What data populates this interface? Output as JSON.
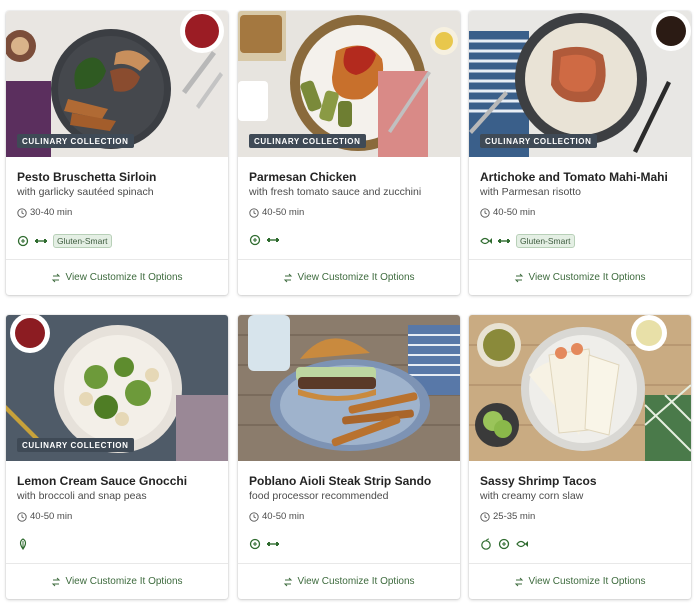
{
  "badge_label": "CULINARY COLLECTION",
  "customize_label": "View Customize It Options",
  "colors": {
    "accent_green": "#3e6b3e",
    "chip_bg": "#e4efe4",
    "badge_bg": "#3f4a56"
  },
  "cards": [
    {
      "title": "Pesto Bruschetta Sirloin",
      "subtitle": "with garlicky sautéed spinach",
      "time": "30-40 min",
      "badge": true,
      "tags": [
        "calorie-icon",
        "protein-icon"
      ],
      "chip": "Gluten-Smart"
    },
    {
      "title": "Parmesan Chicken",
      "subtitle": "with fresh tomato sauce and zucchini",
      "time": "40-50 min",
      "badge": true,
      "tags": [
        "calorie-icon",
        "protein-icon"
      ],
      "chip": ""
    },
    {
      "title": "Artichoke and Tomato Mahi-Mahi",
      "subtitle": "with Parmesan risotto",
      "time": "40-50 min",
      "badge": true,
      "tags": [
        "fish-icon",
        "protein-icon"
      ],
      "chip": "Gluten-Smart"
    },
    {
      "title": "Lemon Cream Sauce Gnocchi",
      "subtitle": "with broccoli and snap peas",
      "time": "40-50 min",
      "badge": true,
      "tags": [
        "veggie-icon"
      ],
      "chip": ""
    },
    {
      "title": "Poblano Aioli Steak Strip Sando",
      "subtitle": "food processor recommended",
      "time": "40-50 min",
      "badge": false,
      "tags": [
        "calorie-icon",
        "protein-icon"
      ],
      "chip": ""
    },
    {
      "title": "Sassy Shrimp Tacos",
      "subtitle": "with creamy corn slaw",
      "time": "25-35 min",
      "badge": false,
      "tags": [
        "apple-icon",
        "calorie-icon",
        "fish-icon"
      ],
      "chip": ""
    }
  ]
}
